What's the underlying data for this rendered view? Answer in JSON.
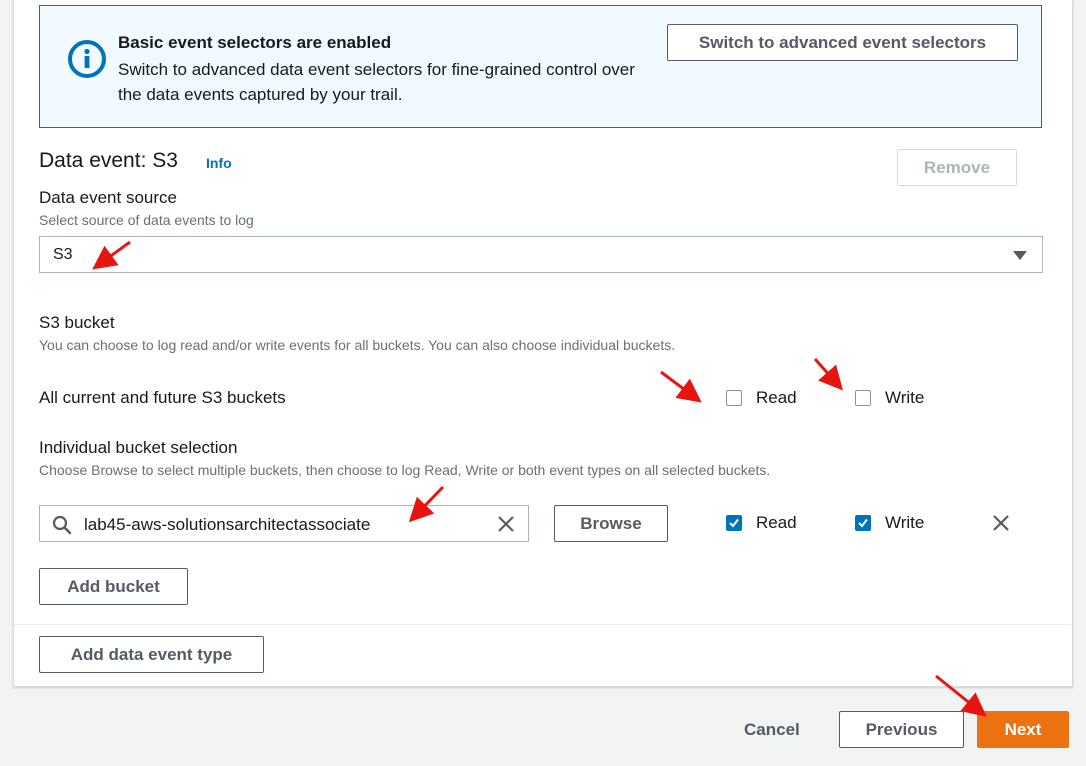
{
  "alert": {
    "title": "Basic event selectors are enabled",
    "text": "Switch to advanced data event selectors for fine-grained control over the data events captured by your trail.",
    "switch_button": "Switch to advanced event selectors"
  },
  "data_event": {
    "title": "Data event: S3",
    "info": "Info",
    "remove": "Remove",
    "source_label": "Data event source",
    "source_desc": "Select source of data events to log",
    "source_value": "S3"
  },
  "bucket": {
    "label": "S3 bucket",
    "desc": "You can choose to log read and/or write events for all buckets. You can also choose individual buckets.",
    "all_label": "All current and future S3 buckets",
    "all_read": "Read",
    "all_write": "Write",
    "individual_label": "Individual bucket selection",
    "individual_desc": "Choose Browse to select multiple buckets, then choose to log Read, Write or both event types on all selected buckets.",
    "search_value": "lab45-aws-solutionsarchitectassociate",
    "browse": "Browse",
    "ind_read": "Read",
    "ind_write": "Write",
    "add_bucket": "Add bucket"
  },
  "add_data_event_type": "Add data event type",
  "footer": {
    "cancel": "Cancel",
    "previous": "Previous",
    "next": "Next"
  },
  "colors": {
    "accent": "#0073bb",
    "primary_button": "#ec7211",
    "annotation_arrow": "#e8140f"
  },
  "checkbox_state": {
    "all_read": false,
    "all_write": false,
    "ind_read": true,
    "ind_write": true
  }
}
